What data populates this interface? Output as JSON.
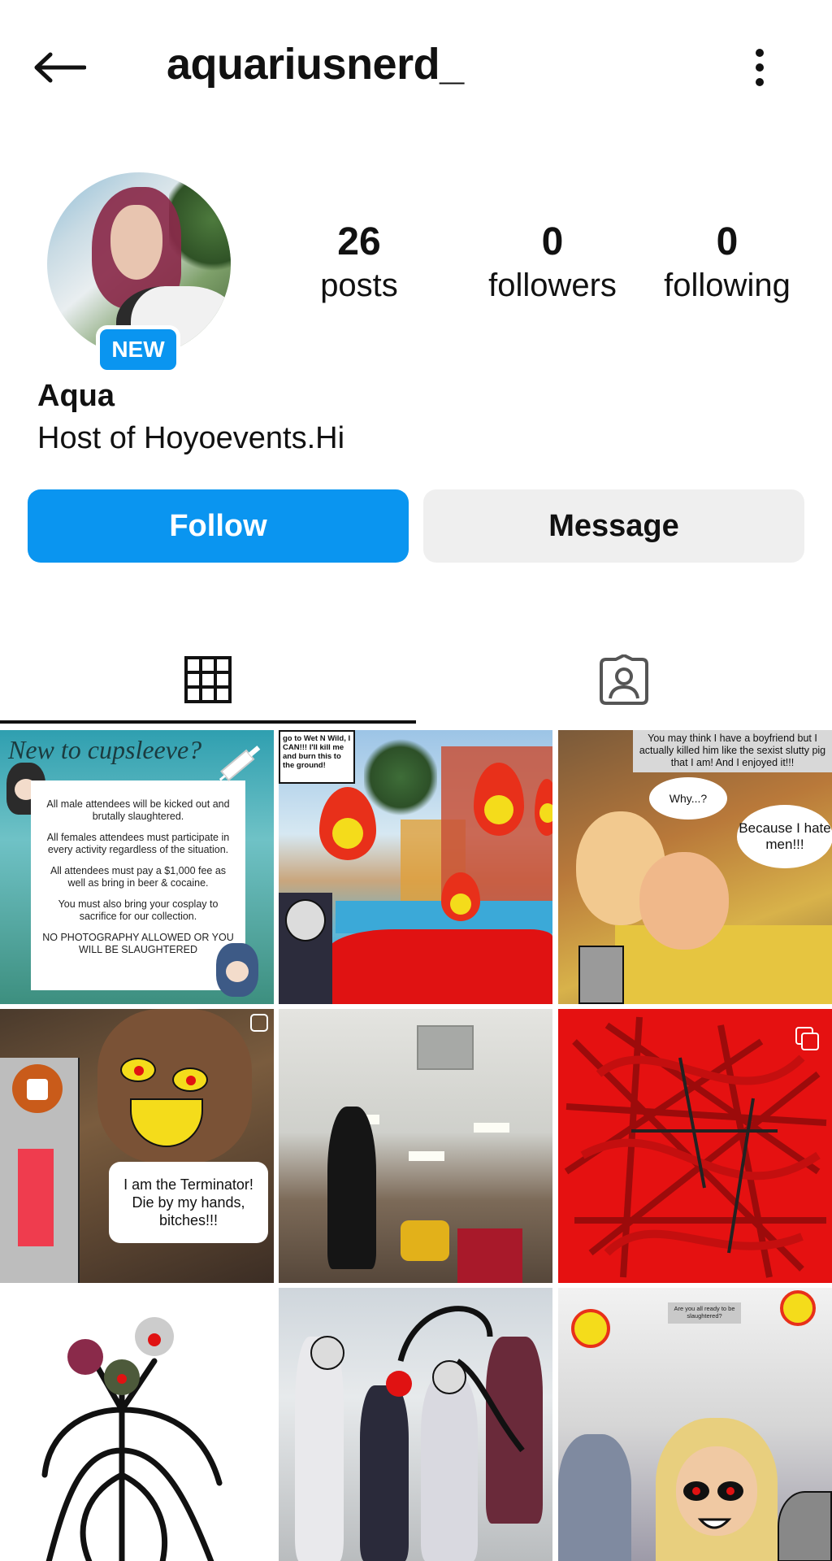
{
  "header": {
    "username": "aquariusnerd_",
    "back_icon": "arrow-left-icon",
    "more_icon": "more-vertical-icon"
  },
  "profile": {
    "new_badge": "NEW",
    "display_name": "Aqua",
    "bio": "Host of Hoyoevents.Hi",
    "stats": [
      {
        "value": "26",
        "label": "posts"
      },
      {
        "value": "0",
        "label": "followers"
      },
      {
        "value": "0",
        "label": "following"
      }
    ]
  },
  "actions": {
    "follow_label": "Follow",
    "message_label": "Message"
  },
  "tabs": {
    "grid_icon": "grid-icon",
    "tagged_icon": "tagged-person-icon"
  },
  "colors": {
    "accent": "#0a95f0",
    "secondary_button": "#efefef"
  },
  "posts": {
    "p1": {
      "header": "New to cupsleeve?",
      "lines": [
        "All male attendees will be kicked out and brutally slaughtered.",
        "All females attendees must participate in every activity regardless of the situation.",
        "All attendees must pay a $1,000 fee as well as bring in beer & cocaine.",
        "You must also bring your cosplay to sacrifice for our collection.",
        "NO PHOTOGRAPHY ALLOWED OR YOU WILL BE SLAUGHTERED"
      ]
    },
    "p2": {
      "note": "go to Wet N Wild, I CAN!!! I'll kill me and burn this to the ground!"
    },
    "p3": {
      "caption": "You may think I have a boyfriend but I actually killed him like the sexist slutty pig that I am! And I enjoyed it!!!",
      "bubble1": "Why...?",
      "bubble2": "Because I hate men!!!"
    },
    "p4": {
      "speech": "I am the Terminator! Die by my hands, bitches!!!",
      "reel_icon": "reel-icon"
    },
    "p6": {
      "multi_icon": "multiple-images-icon"
    },
    "p9": {
      "sign": "Are you all ready to be slaughtered?"
    }
  }
}
